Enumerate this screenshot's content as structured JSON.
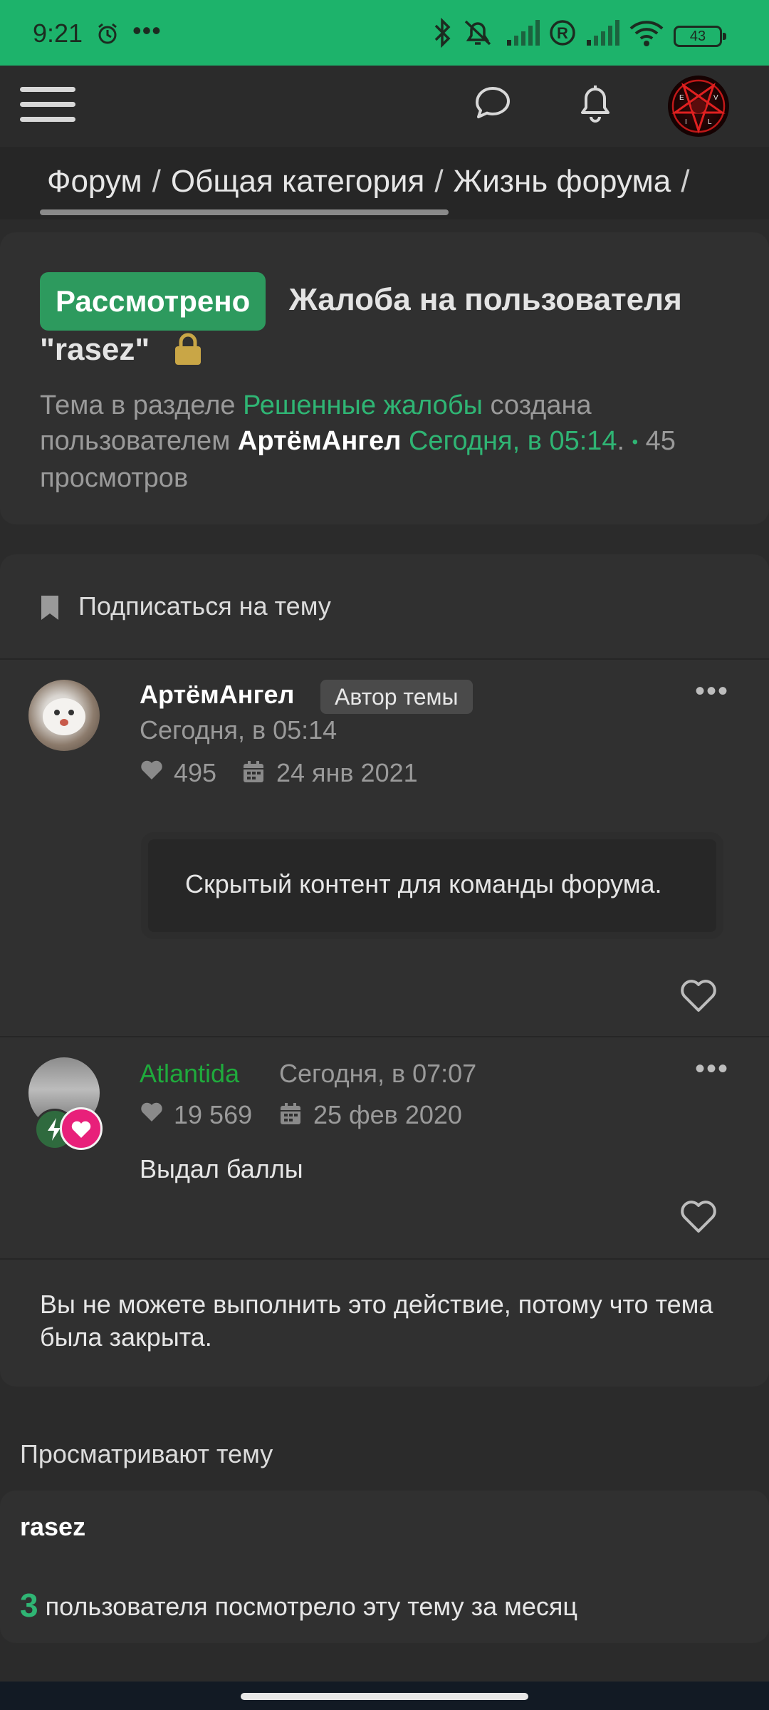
{
  "status_bar": {
    "time": "9:21",
    "more": "•••",
    "battery": "43"
  },
  "breadcrumb": {
    "items": [
      "Форум",
      "Общая категория",
      "Жизнь форума"
    ],
    "separator": "/",
    "overflow": "/"
  },
  "thread": {
    "status_tag": "Рассмотрено",
    "title_line1": "Жалоба на пользователя",
    "title_line2": "\"rasez\"",
    "meta_prefix": "Тема в разделе ",
    "section_link": "Решенные жалобы",
    "meta_created": " создана пользователем ",
    "author": "АртёмАнгел",
    "created_time": "Сегодня, в 05:14",
    "period": ".",
    "dot": "•",
    "views": " 45 просмотров"
  },
  "subscribe_label": "Подписаться на тему",
  "posts": [
    {
      "author": "АртёмАнгел",
      "badge": "Автор темы",
      "time": "Сегодня, в 05:14",
      "likes": "495",
      "joined": "24 янв 2021",
      "hidden_text": "Скрытый контент для команды форума.",
      "more": "•••"
    },
    {
      "author": "Atlantida",
      "time": "Сегодня, в 07:07",
      "likes": "19 569",
      "joined": "25 фев 2020",
      "body": "Выдал баллы",
      "more": "•••"
    }
  ],
  "closed_note": "Вы не можете выполнить это действие, потому что тема была закрыта.",
  "viewing": {
    "title": "Просматривают тему",
    "viewer": "rasez",
    "count": "3",
    "count_text": " пользователя посмотрело эту тему за месяц"
  },
  "colors": {
    "accent": "#2fb574",
    "status_bar": "#1db36b",
    "tag": "#2d9a5e",
    "username_green": "#1faa3c"
  }
}
